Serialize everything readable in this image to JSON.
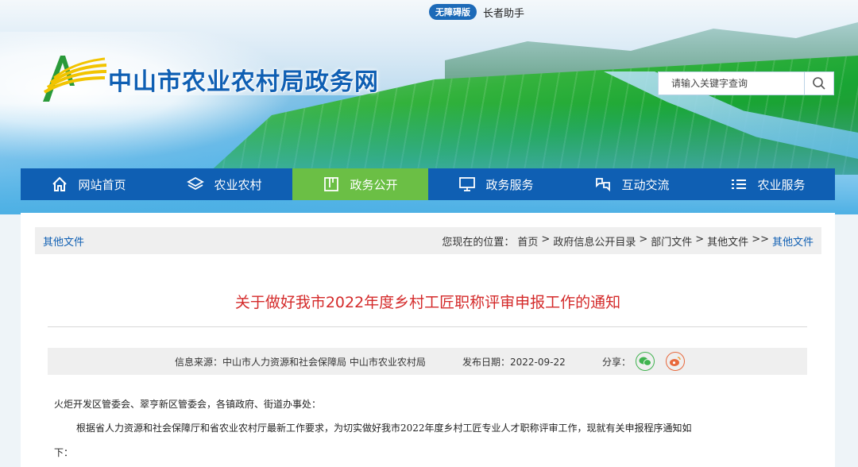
{
  "header": {
    "accessibility_badge": "无障碍版",
    "elder_assist": "长者助手",
    "site_title": "中山市农业农村局政务网",
    "search_placeholder": "请输入关键字查询"
  },
  "nav": {
    "items": [
      {
        "label": "网站首页",
        "icon": "home-icon"
      },
      {
        "label": "农业农村",
        "icon": "layers-icon"
      },
      {
        "label": "政务公开",
        "icon": "book-icon",
        "active": true
      },
      {
        "label": "政务服务",
        "icon": "monitor-icon"
      },
      {
        "label": "互动交流",
        "icon": "chat-icon"
      },
      {
        "label": "农业服务",
        "icon": "list-icon"
      }
    ]
  },
  "breadcrumb": {
    "section": "其他文件",
    "prefix": "您现在的位置：",
    "path": [
      "首页",
      ">",
      "政府信息公开目录",
      ">",
      "部门文件",
      ">",
      "其他文件",
      ">>"
    ],
    "current": "其他文件"
  },
  "article": {
    "title": "关于做好我市2022年度乡村工匠职称评审申报工作的通知",
    "source": "信息来源：中山市人力资源和社会保障局 中山市农业农村局",
    "date": "发布日期：2022-09-22",
    "share_label": "分享：",
    "para1": "火炬开发区管委会、翠亨新区管委会，各镇政府、街道办事处：",
    "para2": "根据省人力资源和社会保障厅和省农业农村厅最新工作要求，为切实做好我市2022年度乡村工匠专业人才职称评审工作，现就有关申报程序通知如",
    "para3": "下："
  },
  "colors": {
    "brand_blue": "#0f5fb3",
    "nav_active_green": "#6bbf45",
    "title_red": "#d42a2a"
  }
}
